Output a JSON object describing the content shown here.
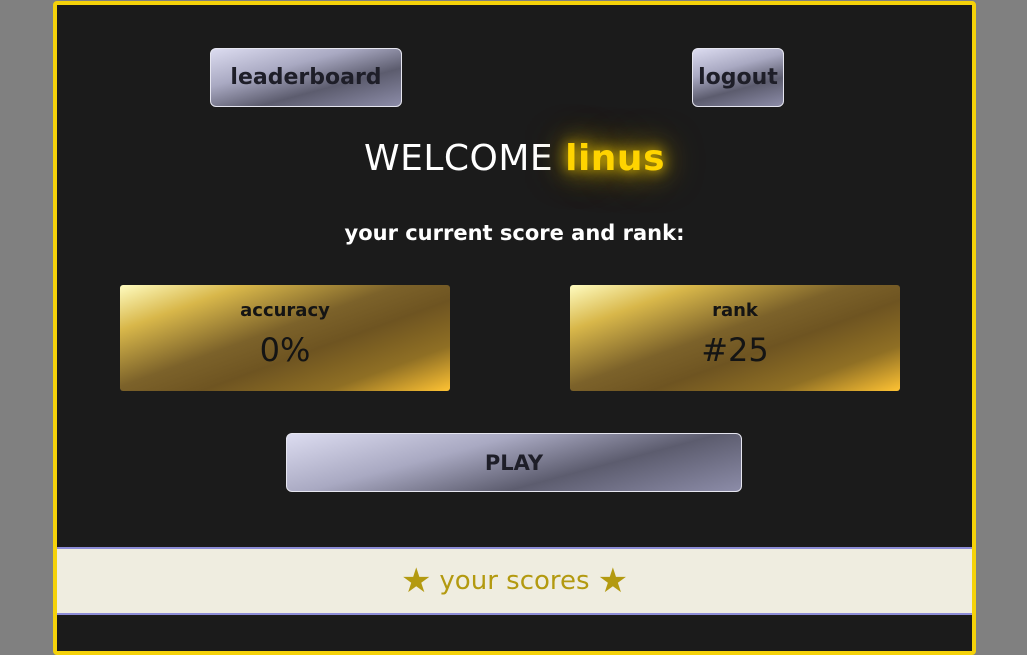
{
  "nav": {
    "leaderboard_label": "leaderboard",
    "logout_label": "logout"
  },
  "welcome": {
    "prefix": "WELCOME",
    "username": "linus"
  },
  "subtitle": "your current score and rank:",
  "stats": {
    "accuracy_label": "accuracy",
    "accuracy_value": "0%",
    "rank_label": "rank",
    "rank_value": "#25"
  },
  "play_label": "PLAY",
  "scores": {
    "label": "your scores",
    "left_icon": "star-icon",
    "right_icon": "star-icon"
  },
  "colors": {
    "accent": "#f5d20a",
    "background": "#1b1b1b",
    "scores_text": "#b39a10"
  }
}
